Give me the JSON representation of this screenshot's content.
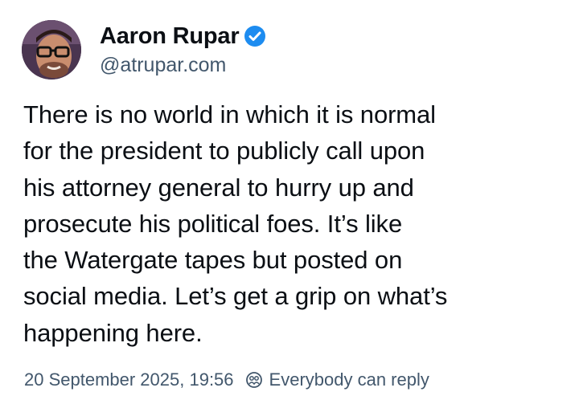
{
  "author": {
    "display_name": "Aaron Rupar",
    "handle": "@atrupar.com",
    "verified": true,
    "verified_color": "#1d8cf0"
  },
  "post": {
    "text": "There is no world in which it is normal\nfor the president to publicly call upon\nhis attorney general to hurry up and\nprosecute his political foes. It’s like\nthe Watergate tapes but posted on\nsocial media. Let’s get a grip on what’s\nhappening here.",
    "timestamp": "20 September 2025, 19:56",
    "reply_setting": "Everybody can reply"
  },
  "icons": {
    "avatar": "profile-photo",
    "verified": "verified-check-icon",
    "reply": "reply-restriction-icon"
  },
  "colors": {
    "text": "#0b0f14",
    "secondary": "#42576c",
    "accent": "#1d8cf0"
  }
}
